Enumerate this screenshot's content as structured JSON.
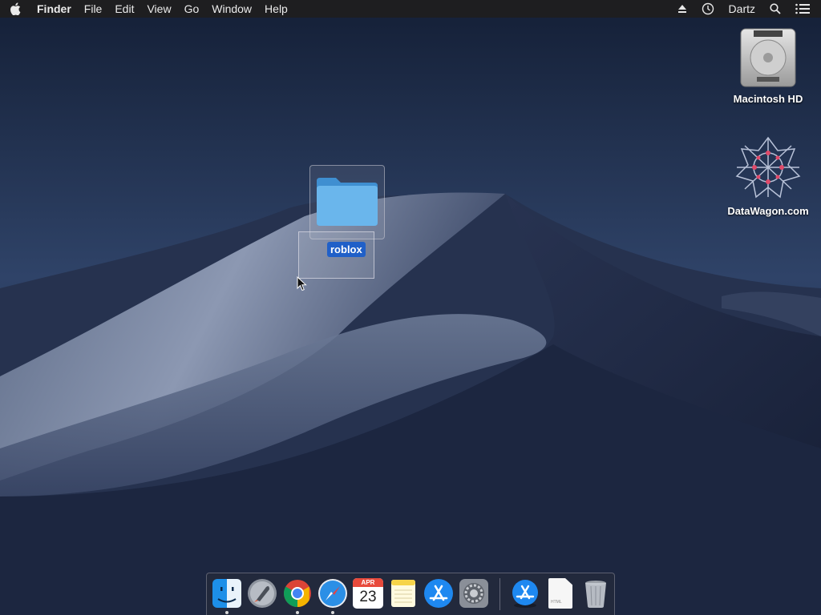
{
  "menubar": {
    "apple_icon": "apple-icon",
    "app_name": "Finder",
    "items": [
      "File",
      "Edit",
      "View",
      "Go",
      "Window",
      "Help"
    ],
    "status": {
      "eject_icon": "eject-icon",
      "clock_icon": "time-machine-icon",
      "user": "Dartz",
      "spotlight_icon": "search-icon",
      "notification_icon": "list-icon"
    }
  },
  "desktop": {
    "icons": [
      {
        "label": "Macintosh HD",
        "icon": "hard-drive-icon"
      },
      {
        "label": "DataWagon.com",
        "icon": "datawagon-logo-icon"
      }
    ],
    "dragged_folder": {
      "label": "roblox",
      "icon": "folder-icon",
      "selected": true
    }
  },
  "dock": {
    "items": [
      {
        "name": "Finder",
        "icon": "finder-icon",
        "running": true
      },
      {
        "name": "Launchpad",
        "icon": "launchpad-icon",
        "running": false
      },
      {
        "name": "Google Chrome",
        "icon": "chrome-icon",
        "running": true
      },
      {
        "name": "Safari",
        "icon": "safari-icon",
        "running": true
      },
      {
        "name": "Calendar",
        "icon": "calendar-icon",
        "running": false,
        "month": "APR",
        "day": "23"
      },
      {
        "name": "Notes",
        "icon": "notes-icon",
        "running": false
      },
      {
        "name": "App Store",
        "icon": "app-store-icon",
        "running": false
      },
      {
        "name": "System Preferences",
        "icon": "system-preferences-icon",
        "running": false
      },
      {
        "name": "App Store Downloads",
        "icon": "app-store-folder-icon",
        "running": false
      },
      {
        "name": "Document",
        "icon": "html-document-icon",
        "running": false,
        "file_tag": "HTML"
      },
      {
        "name": "Trash",
        "icon": "trash-icon",
        "running": false
      }
    ]
  },
  "colors": {
    "menubar_bg": "#1e1e20",
    "sky_dark": "#141f36",
    "sky_light": "#2f4368",
    "selection_blue": "#2060c8"
  }
}
